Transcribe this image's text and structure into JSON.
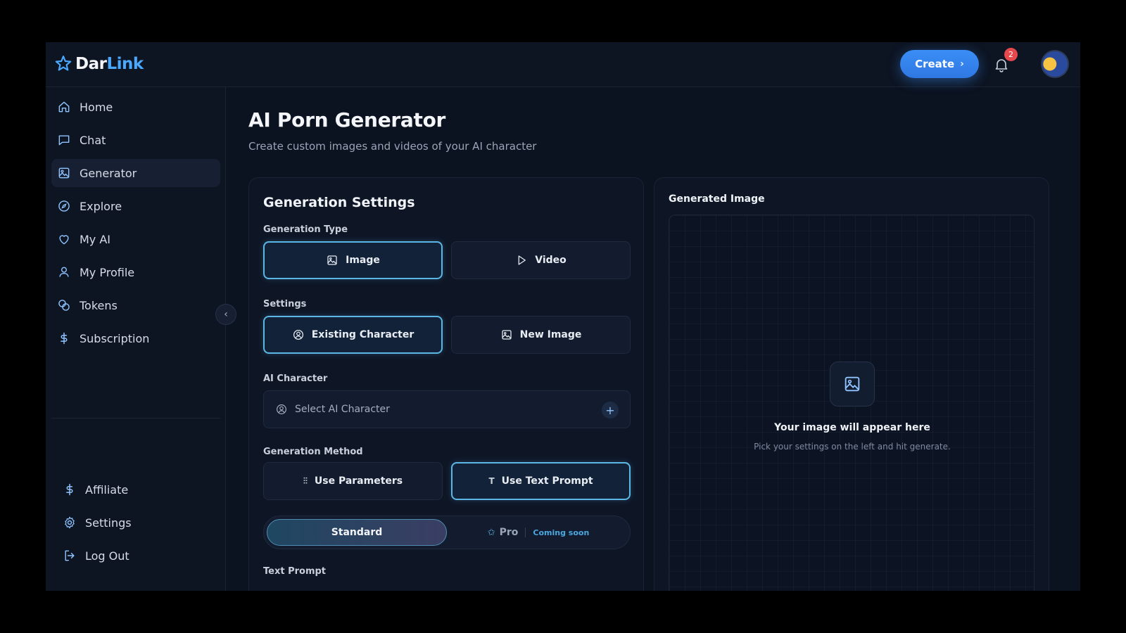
{
  "brand": {
    "name_part1": "Dar",
    "name_part2": "Link",
    "accent": "#4aa8ff"
  },
  "header": {
    "create_label": "Create",
    "notification_count": "2"
  },
  "sidebar": {
    "items": [
      {
        "label": "Home",
        "icon": "home-icon"
      },
      {
        "label": "Chat",
        "icon": "chat-icon"
      },
      {
        "label": "Generator",
        "icon": "image-icon",
        "active": true
      },
      {
        "label": "Explore",
        "icon": "compass-icon"
      },
      {
        "label": "My AI",
        "icon": "heart-icon"
      },
      {
        "label": "My Profile",
        "icon": "user-icon"
      },
      {
        "label": "Tokens",
        "icon": "coins-icon"
      },
      {
        "label": "Subscription",
        "icon": "dollar-icon"
      }
    ],
    "bottom": [
      {
        "label": "Affiliate",
        "icon": "dollar-icon"
      },
      {
        "label": "Settings",
        "icon": "gear-icon"
      },
      {
        "label": "Log Out",
        "icon": "logout-icon"
      }
    ]
  },
  "page": {
    "title": "AI Porn Generator",
    "subtitle": "Create custom images and videos of your AI character"
  },
  "settings": {
    "title": "Generation Settings",
    "generation_type_label": "Generation Type",
    "type_image": "Image",
    "type_video": "Video",
    "settings_label": "Settings",
    "existing_character": "Existing Character",
    "new_image": "New Image",
    "ai_character_label": "AI Character",
    "ai_character_placeholder": "Select AI Character",
    "method_label": "Generation Method",
    "use_parameters": "Use Parameters",
    "use_text_prompt": "Use Text Prompt",
    "standard": "Standard",
    "pro": "Pro",
    "coming_soon": "Coming soon",
    "text_prompt_label": "Text Prompt"
  },
  "preview": {
    "title": "Generated Image",
    "placeholder_title": "Your image will appear here",
    "placeholder_sub": "Pick your settings on the left and hit generate."
  }
}
